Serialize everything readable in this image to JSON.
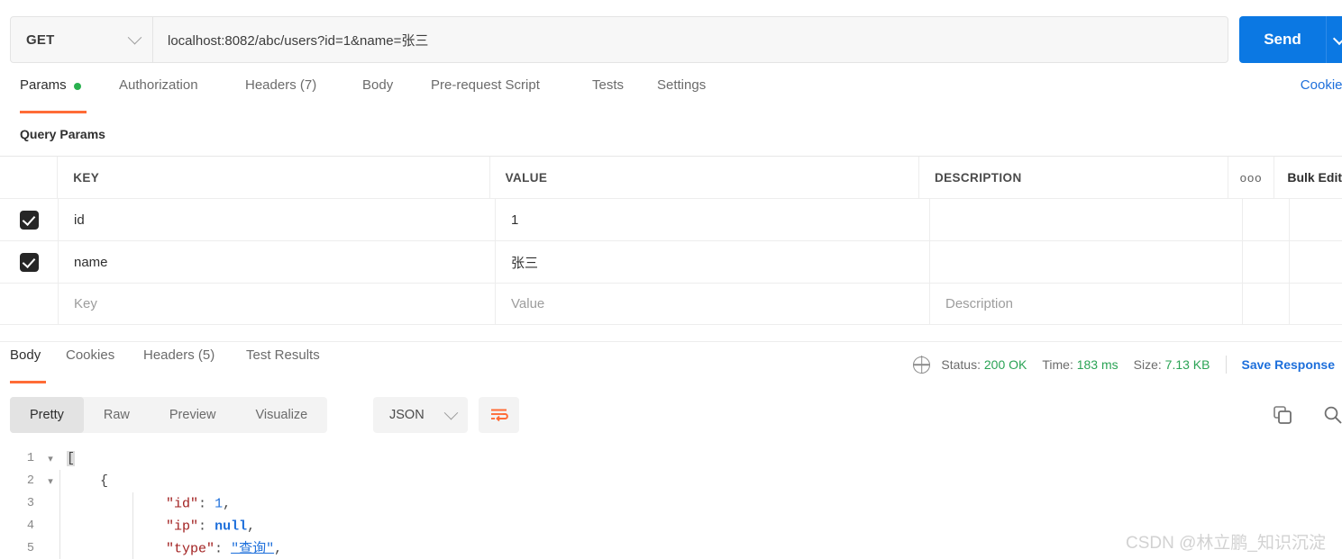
{
  "request": {
    "method": "GET",
    "url": "localhost:8082/abc/users?id=1&name=张三",
    "send_label": "Send",
    "tabs": [
      {
        "label": "Params",
        "active": true,
        "dot": true
      },
      {
        "label": "Authorization",
        "active": false,
        "dot": false
      },
      {
        "label": "Headers (7)",
        "active": false,
        "dot": false
      },
      {
        "label": "Body",
        "active": false,
        "dot": false
      },
      {
        "label": "Pre-request Script",
        "active": false,
        "dot": false
      },
      {
        "label": "Tests",
        "active": false,
        "dot": false
      },
      {
        "label": "Settings",
        "active": false,
        "dot": false
      }
    ],
    "cookies_link": "Cookies"
  },
  "query_params": {
    "title": "Query Params",
    "headers": {
      "key": "KEY",
      "value": "VALUE",
      "description": "DESCRIPTION",
      "more": "ooo",
      "bulk": "Bulk Edit"
    },
    "rows": [
      {
        "checked": true,
        "key": "id",
        "value": "1",
        "description": ""
      },
      {
        "checked": true,
        "key": "name",
        "value": "张三",
        "description": ""
      }
    ],
    "placeholders": {
      "key": "Key",
      "value": "Value",
      "description": "Description"
    }
  },
  "response": {
    "tabs": [
      {
        "label": "Body",
        "active": true
      },
      {
        "label": "Cookies",
        "active": false
      },
      {
        "label": "Headers (5)",
        "active": false
      },
      {
        "label": "Test Results",
        "active": false
      }
    ],
    "status": {
      "status_label": "Status:",
      "status_value": "200 OK",
      "time_label": "Time:",
      "time_value": "183 ms",
      "size_label": "Size:",
      "size_value": "7.13 KB"
    },
    "save_response": "Save Response",
    "view_modes": [
      {
        "label": "Pretty",
        "active": true
      },
      {
        "label": "Raw",
        "active": false
      },
      {
        "label": "Preview",
        "active": false
      },
      {
        "label": "Visualize",
        "active": false
      }
    ],
    "format": "JSON",
    "code_lines": [
      {
        "num": "1",
        "foldable": true,
        "indent": 0
      },
      {
        "num": "2",
        "foldable": true,
        "indent": 1
      },
      {
        "num": "3",
        "foldable": false,
        "indent": 2
      },
      {
        "num": "4",
        "foldable": false,
        "indent": 2
      },
      {
        "num": "5",
        "foldable": false,
        "indent": 2
      }
    ],
    "code_text": {
      "l1": "[",
      "l2": "{",
      "l3_key": "\"id\"",
      "l3_val": "1",
      "l4_key": "\"ip\"",
      "l4_val": "null",
      "l5_key": "\"type\"",
      "l5_val": "\"查询\""
    }
  },
  "watermark": "CSDN @林立鹏_知识沉淀",
  "colors": {
    "accent_orange": "#ff6c37",
    "send_blue": "#0b78e3",
    "link_blue": "#1d6fdb",
    "status_green": "#2aa355",
    "param_dot_green": "#2ab14f"
  }
}
